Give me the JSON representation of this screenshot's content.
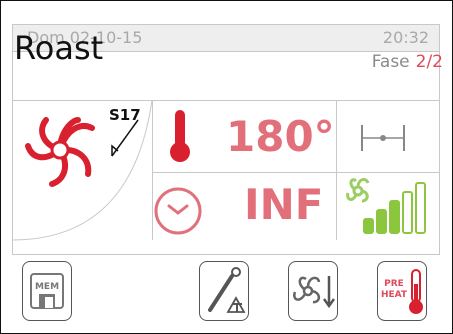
{
  "status_bar": {
    "date": "Dom 02-10-15",
    "time": "20:32"
  },
  "program": {
    "title": "Roast",
    "phase_label": "Fase",
    "phase_value": "2/2"
  },
  "fan": {
    "label": "S17"
  },
  "temperature": {
    "value": "180°"
  },
  "timer": {
    "value": "INF"
  },
  "fan_speed": {
    "level": 3,
    "max": 5
  },
  "accent_color": "#e04a5a",
  "buttons": {
    "memory": {
      "label": "MEM",
      "icon": "floppy-disk-icon"
    },
    "probe": {
      "icon": "core-probe-icon"
    },
    "fan_cooling": {
      "icon": "fan-cooling-icon"
    },
    "preheat": {
      "label_line1": "PRE",
      "label_line2": "HEAT",
      "icon": "preheat-thermometer-icon"
    }
  }
}
